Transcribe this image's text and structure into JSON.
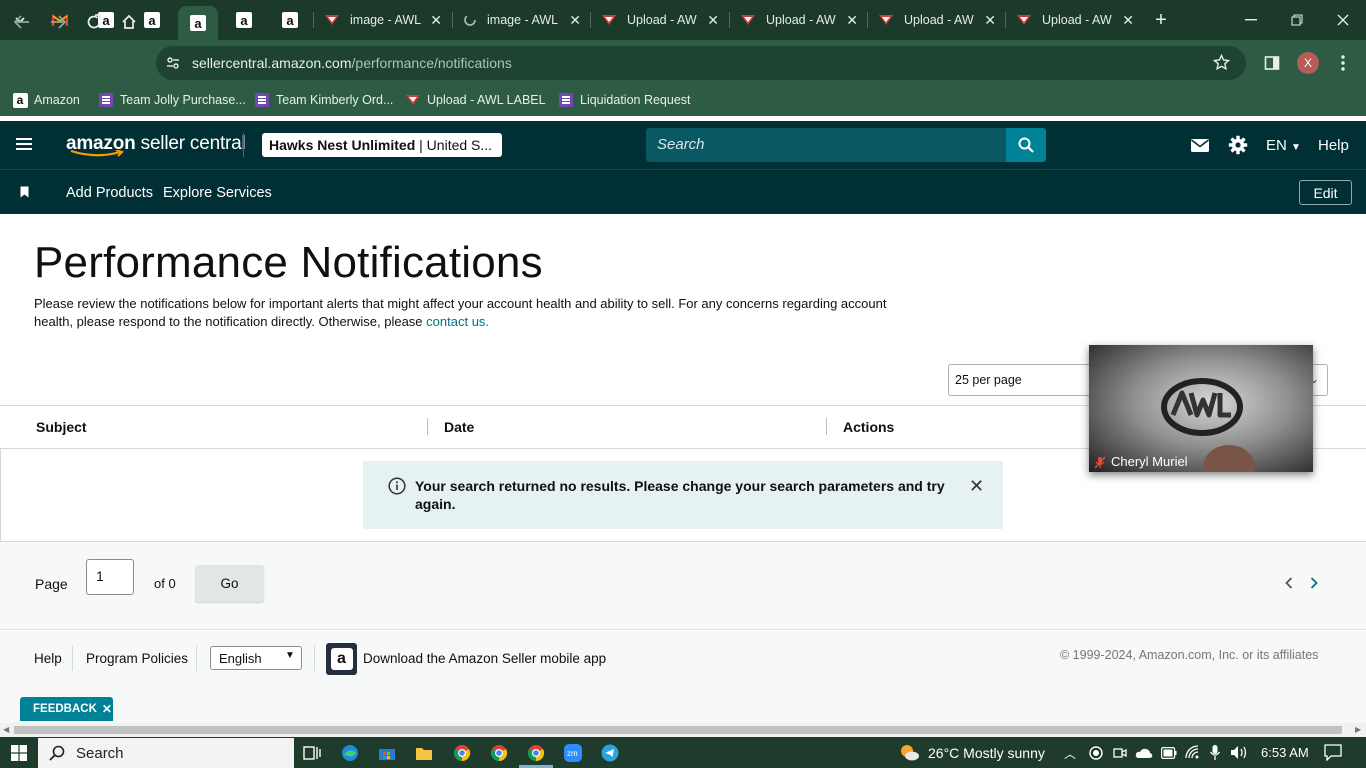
{
  "browser": {
    "tabs": [
      {
        "title": "image - AWL"
      },
      {
        "title": "image - AWL"
      },
      {
        "title": "Upload - AW"
      },
      {
        "title": "Upload - AW"
      },
      {
        "title": "Upload - AW"
      },
      {
        "title": "Upload - AW"
      }
    ],
    "url_host": "sellercentral.amazon.com",
    "url_path": "/performance/notifications",
    "profile_initial": "X",
    "bookmarks": [
      {
        "label": "Amazon"
      },
      {
        "label": "Team Jolly Purchase..."
      },
      {
        "label": "Team Kimberly Ord..."
      },
      {
        "label": "Upload - AWL LABEL"
      },
      {
        "label": "Liquidation Request"
      }
    ]
  },
  "header": {
    "logo_brand": "amazon",
    "logo_suffix": "seller central",
    "account_name": "Hawks Nest Unlimited",
    "account_region": "| United S...",
    "search_placeholder": "Search",
    "language": "EN",
    "help": "Help"
  },
  "subnav": {
    "links": [
      {
        "label": "Add Products"
      },
      {
        "label": "Explore Services"
      }
    ],
    "edit_label": "Edit"
  },
  "main": {
    "title": "Performance Notifications",
    "intro": "Please review the notifications below for important alerts that might affect your account health and ability to sell. For any concerns regarding account health, please respond to the notification directly. Otherwise, please",
    "contact_link": "contact us.",
    "per_page": "25 per page",
    "columns": [
      "Subject",
      "Date",
      "Actions"
    ],
    "empty_message": "Your search returned no results. Please change your search parameters and try again."
  },
  "pager": {
    "page_label": "Page",
    "page_value": "1",
    "of_label": "of 0",
    "go_label": "Go"
  },
  "footer": {
    "links": [
      {
        "label": "Help"
      },
      {
        "label": "Program Policies"
      }
    ],
    "language_selected": "English",
    "app_text": "Download the Amazon Seller mobile app",
    "copyright": "© 1999-2024, Amazon.com, Inc. or its affiliates",
    "feedback": "FEEDBACK"
  },
  "video": {
    "participant": "Cheryl Muriel"
  },
  "taskbar": {
    "search": "Search",
    "weather": "26°C  Mostly sunny",
    "time": "6:53 AM"
  }
}
